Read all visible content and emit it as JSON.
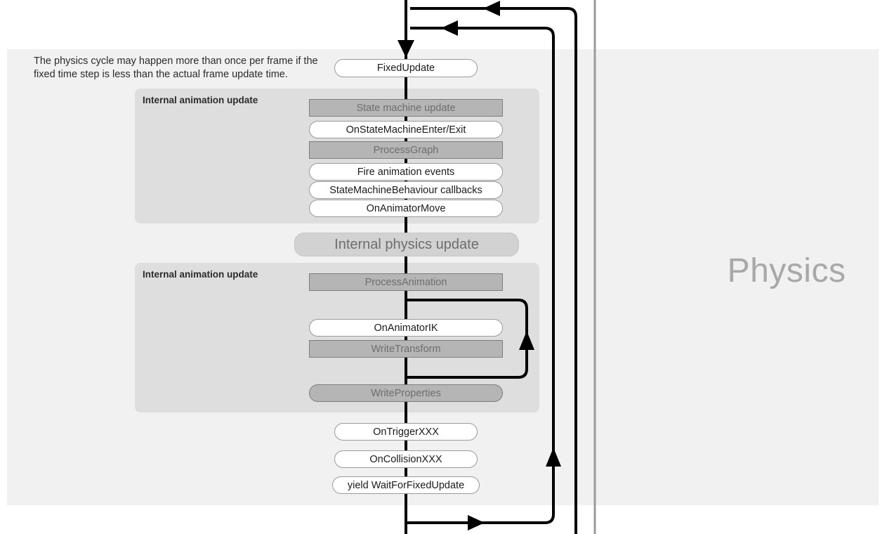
{
  "note": {
    "text": "The physics cycle may happen more than once per frame if the fixed time step is less than the actual frame update time."
  },
  "panel": {
    "label": "Physics",
    "background_color": "#f1f1f1",
    "label_color": "#a8a8a8"
  },
  "entry": {
    "label": "FixedUpdate"
  },
  "groups": [
    {
      "title": "Internal animation update"
    },
    {
      "title": "Internal animation update"
    }
  ],
  "banner": {
    "label": "Internal physics update"
  },
  "nodes": {
    "state_machine_update": "State machine update",
    "on_state_machine_enter_exit": "OnStateMachineEnter/Exit",
    "process_graph": "ProcessGraph",
    "fire_animation_events": "Fire animation events",
    "state_machine_behaviour_callbacks": "StateMachineBehaviour callbacks",
    "on_animator_move": "OnAnimatorMove",
    "process_animation": "ProcessAnimation",
    "on_animator_ik": "OnAnimatorIK",
    "write_transform": "WriteTransform",
    "write_properties": "WriteProperties",
    "on_trigger_xxx": "OnTriggerXXX",
    "on_collision_xxx": "OnCollisionXXX",
    "yield_wait_for_fixed_update": "yield WaitForFixedUpdate"
  },
  "colors": {
    "panel_bg": "#f1f1f1",
    "group_bg": "#dedede",
    "gray_node_fill": "#b5b5b5",
    "gray_node_border": "#7d7d7d",
    "gray_node_text": "#6d6d6d",
    "pill_fill": "#ffffff",
    "pill_border": "#9a9a9a",
    "banner_fill": "#d2d2d2",
    "wire": "#000000",
    "divider": "#9a9a9a"
  }
}
